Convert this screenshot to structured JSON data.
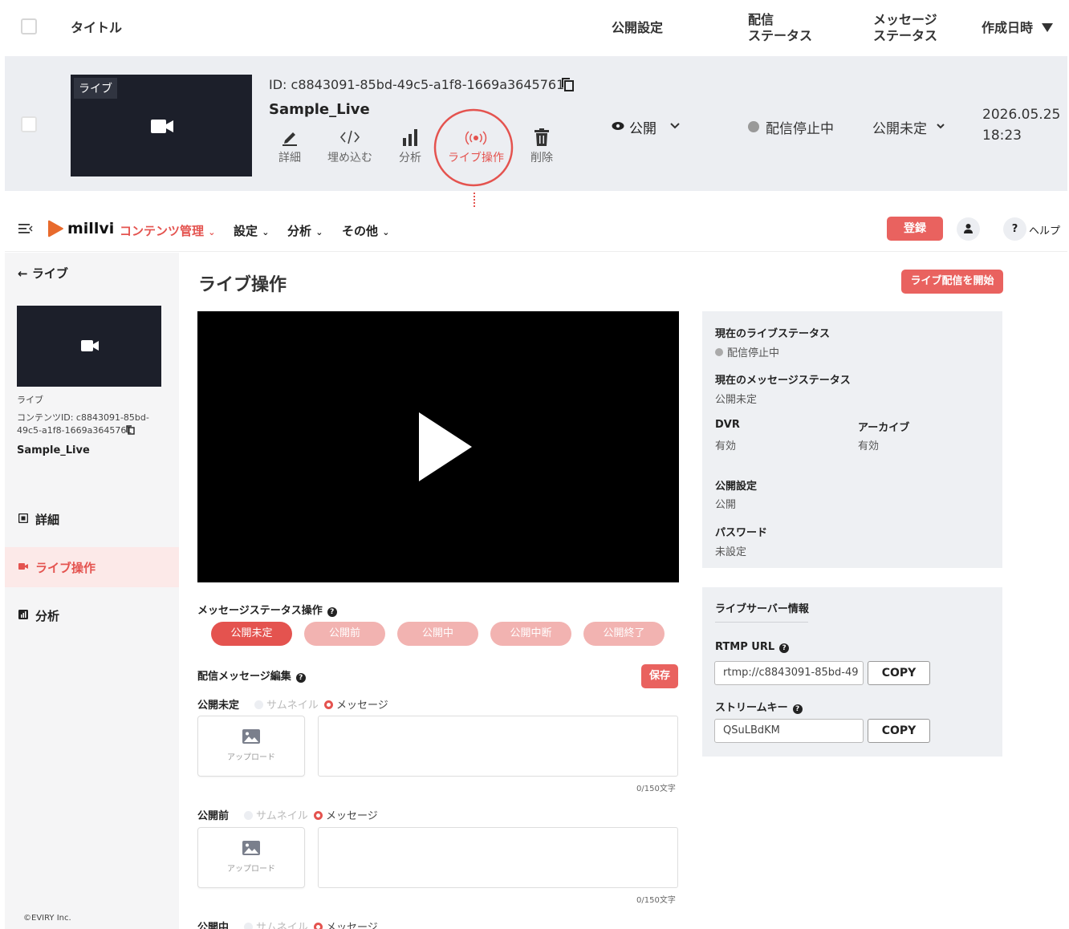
{
  "list": {
    "headers": {
      "title": "タイトル",
      "visibility": "公開設定",
      "stream_status": "配信\nステータス",
      "message_status": "メッセージ\nステータス",
      "created": "作成日時"
    },
    "row": {
      "thumb_label": "ライブ",
      "id": "ID: c8843091-85bd-49c5-a1f8-1669a3645761",
      "name": "Sample_Live",
      "actions": [
        "詳細",
        "埋め込む",
        "分析",
        "ライブ操作",
        "削除"
      ],
      "visibility": "公開",
      "stream_status": "配信停止中",
      "message_status": "公開未定",
      "date": "2026.05.25",
      "time": "18:23"
    }
  },
  "nav": {
    "logo": "millvi",
    "menus": [
      "コンテンツ管理",
      "設定",
      "分析",
      "その他"
    ],
    "register": "登録",
    "help": "ヘルプ"
  },
  "sidebar": {
    "back": "ライブ",
    "type": "ライブ",
    "content_id": "コンテンツID: c8843091-85bd-\n49c5-a1f8-1669a3645761",
    "name": "Sample_Live",
    "items": [
      "詳細",
      "ライブ操作",
      "分析"
    ],
    "footer": "©EVIRY Inc."
  },
  "main": {
    "title": "ライブ操作",
    "start_button": "ライブ配信を開始",
    "message_ops_label": "メッセージステータス操作",
    "pills": [
      "公開未定",
      "公開前",
      "公開中",
      "公開中断",
      "公開終了"
    ],
    "edit_label": "配信メッセージ編集",
    "save": "保存",
    "blocks": [
      {
        "label": "公開未定",
        "thumb": "サムネイル",
        "message": "メッセージ",
        "upload": "アップロード",
        "count": "0/150文字"
      },
      {
        "label": "公開前",
        "thumb": "サムネイル",
        "message": "メッセージ",
        "upload": "アップロード",
        "count": "0/150文字"
      },
      {
        "label": "公開中",
        "thumb": "サムネイル",
        "message": "メッセージ"
      }
    ]
  },
  "status_panel": {
    "live_status_label": "現在のライブステータス",
    "live_status": "配信停止中",
    "msg_status_label": "現在のメッセージステータス",
    "msg_status": "公開未定",
    "dvr_label": "DVR",
    "dvr": "有効",
    "archive_label": "アーカイブ",
    "archive": "有効",
    "visibility_label": "公開設定",
    "visibility": "公開",
    "password_label": "パスワード",
    "password": "未設定"
  },
  "server_panel": {
    "title": "ライブサーバー情報",
    "rtmp_label": "RTMP URL",
    "rtmp": "rtmp://c8843091-85bd-49",
    "key_label": "ストリームキー",
    "key": "QSuLBdKM",
    "copy": "COPY"
  },
  "colors": {
    "accent": "#e4534f",
    "pill_active": "#e4534f",
    "pill_inactive": "#f2b3b1"
  }
}
